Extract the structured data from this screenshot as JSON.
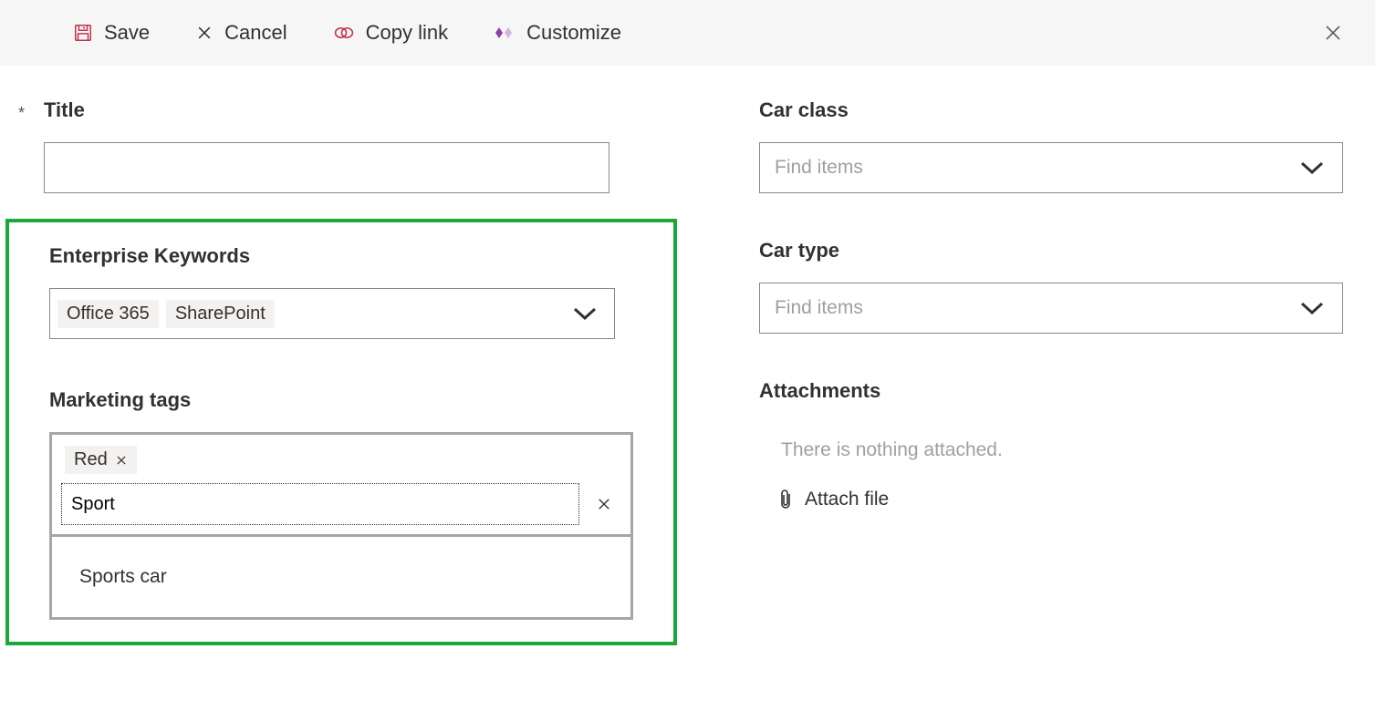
{
  "toolbar": {
    "save_label": "Save",
    "cancel_label": "Cancel",
    "copylink_label": "Copy link",
    "customize_label": "Customize"
  },
  "form": {
    "title_label": "Title",
    "title_value": "",
    "enterprise_keywords_label": "Enterprise Keywords",
    "enterprise_tags": [
      "Office 365",
      "SharePoint"
    ],
    "marketing_label": "Marketing tags",
    "marketing_tags": [
      "Red"
    ],
    "marketing_search_value": "Sport",
    "marketing_suggestion": "Sports car",
    "car_class_label": "Car class",
    "car_class_placeholder": "Find items",
    "car_type_label": "Car type",
    "car_type_placeholder": "Find items",
    "attachments_label": "Attachments",
    "attachments_empty": "There is nothing attached.",
    "attach_file_label": "Attach file"
  }
}
